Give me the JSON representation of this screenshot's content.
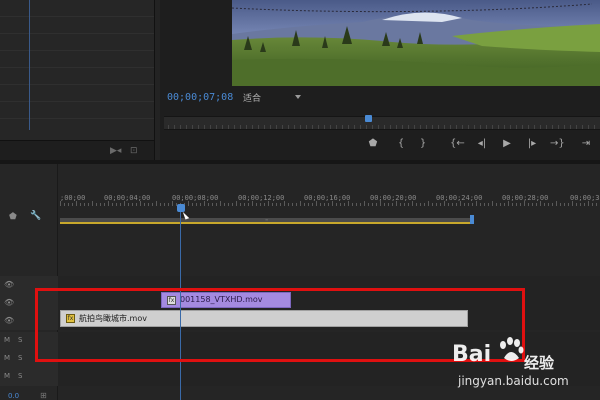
{
  "program_monitor": {
    "timecode": "00;00;07;08",
    "fit_value": "适合"
  },
  "transport_icons": [
    "marker-icon",
    "mark-in-icon",
    "mark-out-icon",
    "go-to-in-icon",
    "step-back-icon",
    "play-icon",
    "step-forward-icon",
    "go-to-out-icon",
    "insert-icon"
  ],
  "transport_glyphs": [
    "⬟",
    "{",
    "}",
    "{←",
    "◂|",
    "▶",
    "|▸",
    "→}",
    "⇥"
  ],
  "timeline": {
    "ruler_labels": [
      ";00;00",
      "00;00;04;00",
      "00;00;08;00",
      "00;00;12;00",
      "00;00;16;00",
      "00;00;20;00",
      "00;00;24;00",
      "00;00;28;00",
      "00;00;3"
    ],
    "tracks": [
      {
        "type": "video",
        "label": ""
      },
      {
        "type": "video",
        "label": ""
      },
      {
        "type": "video",
        "label": ""
      },
      {
        "type": "audio",
        "m": "M",
        "s": "S"
      },
      {
        "type": "audio",
        "m": "M",
        "s": "S"
      },
      {
        "type": "audio",
        "m": "M",
        "s": "S"
      }
    ],
    "clips": {
      "v2_name": "001158_VTXHD.mov",
      "v1_name": "航拍鸟瞰城市.mov"
    },
    "bottom_value": "0.0"
  },
  "watermark": {
    "brand": "Bai",
    "brand_cn": "经验",
    "url": "jingyan.baidu.com"
  },
  "colors": {
    "accent_blue": "#4a8ad4",
    "v2_clip": "#a48ae0",
    "v1_clip": "#cfcfcf",
    "highlight_box": "#e01010",
    "work_area": "#c8a82c"
  }
}
